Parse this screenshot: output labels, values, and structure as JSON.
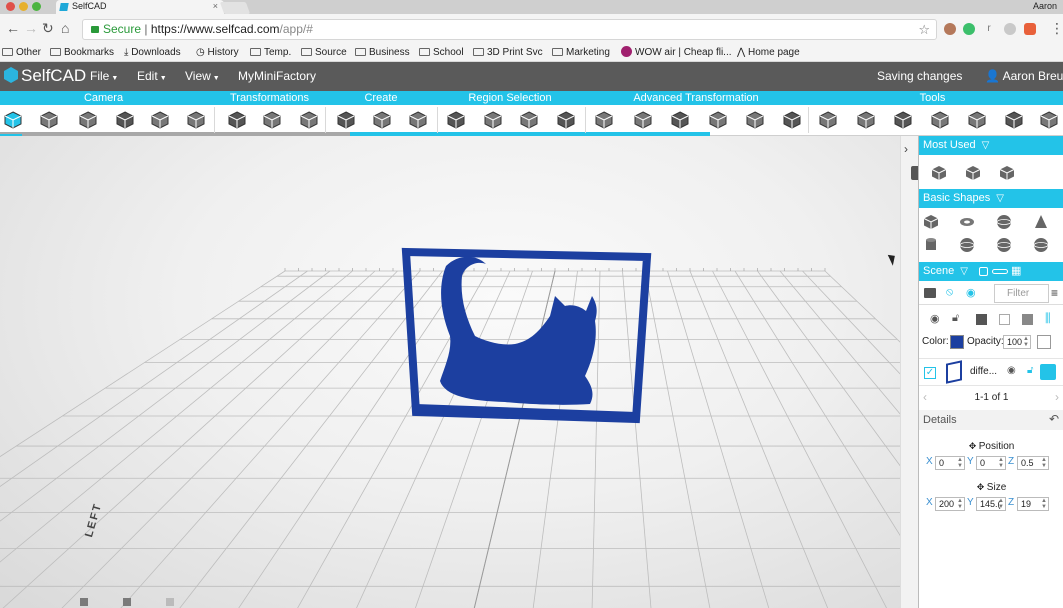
{
  "browser": {
    "tab_title": "SelfCAD",
    "tab_close": "×",
    "user": "Aaron",
    "secure_label": "Secure",
    "url_scheme_host": "https://www.selfcad.com",
    "url_path": "/app/#",
    "bookmarks": [
      {
        "label": "Other",
        "icon": "folder-icon"
      },
      {
        "label": "Bookmarks",
        "icon": "folder-icon"
      },
      {
        "label": "Downloads",
        "icon": "download-icon"
      },
      {
        "label": "History",
        "icon": "history-icon"
      },
      {
        "label": "Temp.",
        "icon": "folder-icon"
      },
      {
        "label": "Source",
        "icon": "folder-icon"
      },
      {
        "label": "Business",
        "icon": "folder-icon"
      },
      {
        "label": "School",
        "icon": "folder-icon"
      },
      {
        "label": "3D Print Svc",
        "icon": "folder-icon"
      },
      {
        "label": "Marketing",
        "icon": "folder-icon"
      },
      {
        "label": "WOW air | Cheap fli...",
        "icon": "wow-icon"
      },
      {
        "label": "Home page",
        "icon": "home-page-icon"
      }
    ]
  },
  "app": {
    "logo": "SelfCAD",
    "menus": [
      "File",
      "Edit",
      "View",
      "MyMiniFactory"
    ],
    "status": "Saving changes",
    "user": "Aaron Breuer"
  },
  "toolbar": {
    "categories": [
      "Camera",
      "Transformations",
      "Create",
      "Region Selection",
      "Advanced Transformation",
      "Tools"
    ]
  },
  "viewport": {
    "axis_label": "LEFT"
  },
  "panel": {
    "most_used": "Most Used",
    "basic_shapes": "Basic Shapes",
    "scene": "Scene",
    "filter_placeholder": "Filter",
    "color_label": "Color:",
    "color_value": "#1c3fa0",
    "opacity_label": "Opacity:",
    "opacity_value": "100",
    "object_name": "diffe...",
    "pagination": "1-1 of 1",
    "details": "Details",
    "position_label": "Position",
    "position": {
      "x": "0",
      "y": "0",
      "z": "0.5"
    },
    "size_label": "Size",
    "size": {
      "x": "200",
      "y": "145.(",
      "z": "19"
    },
    "axes": {
      "x": "X",
      "y": "Y",
      "z": "Z"
    }
  },
  "colors": {
    "accent": "#23c3e8",
    "model_blue": "#1c3fa0",
    "appbar": "#5a5a5a"
  }
}
